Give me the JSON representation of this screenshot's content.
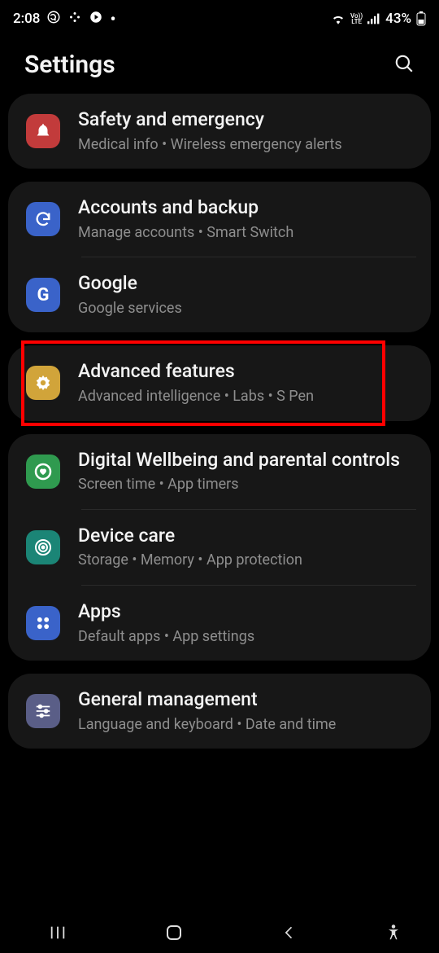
{
  "status": {
    "time": "2:08",
    "battery": "43%",
    "volte": "Vo))\nLTE"
  },
  "header": {
    "title": "Settings"
  },
  "groups": [
    {
      "items": [
        {
          "id": "safety",
          "title": "Safety and emergency",
          "sub": "Medical info  •  Wireless emergency alerts",
          "icon": "alert-icon",
          "cls": "ic-red"
        }
      ]
    },
    {
      "items": [
        {
          "id": "accounts",
          "title": "Accounts and backup",
          "sub": "Manage accounts  •  Smart Switch",
          "icon": "sync-icon",
          "cls": "ic-blue"
        },
        {
          "id": "google",
          "title": "Google",
          "sub": "Google services",
          "icon": "google-icon",
          "cls": "ic-google"
        }
      ]
    },
    {
      "highlight": true,
      "items": [
        {
          "id": "advanced",
          "title": "Advanced features",
          "sub": "Advanced intelligence  •  Labs  •  S Pen",
          "icon": "gear-icon",
          "cls": "ic-yellow"
        }
      ]
    },
    {
      "items": [
        {
          "id": "wellbeing",
          "title": "Digital Wellbeing and parental controls",
          "sub": "Screen time  •  App timers",
          "icon": "heart-icon",
          "cls": "ic-green"
        },
        {
          "id": "devicecare",
          "title": "Device care",
          "sub": "Storage  •  Memory  •  App protection",
          "icon": "target-icon",
          "cls": "ic-teal"
        },
        {
          "id": "apps",
          "title": "Apps",
          "sub": "Default apps  •  App settings",
          "icon": "grid-icon",
          "cls": "ic-blue2"
        }
      ]
    },
    {
      "items": [
        {
          "id": "general",
          "title": "General management",
          "sub": "Language and keyboard  •  Date and time",
          "icon": "sliders-icon",
          "cls": "ic-indigo"
        }
      ]
    }
  ]
}
